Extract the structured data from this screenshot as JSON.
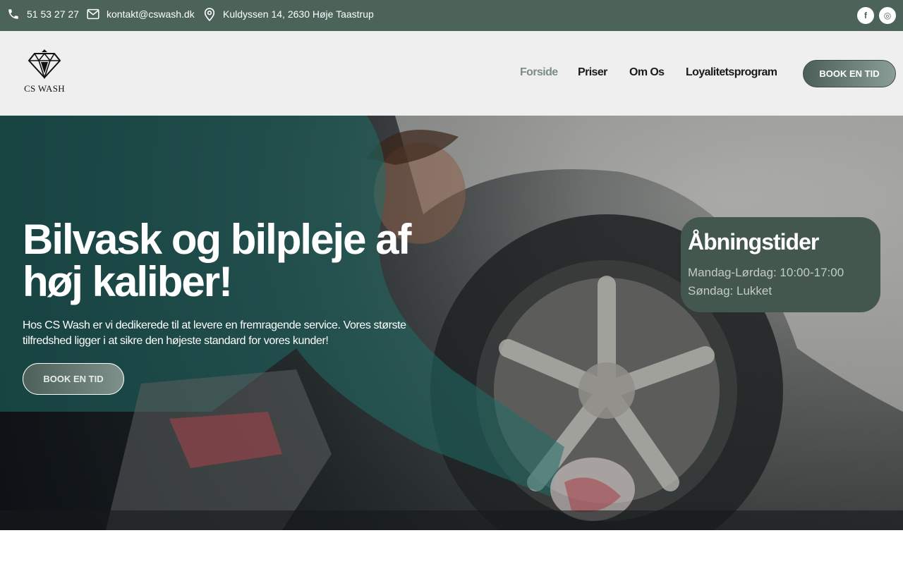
{
  "topbar": {
    "phone": "51 53 27 27",
    "email": "kontakt@cswash.dk",
    "address": "Kuldyssen 14, 2630 Høje Taastrup",
    "icons": [
      "phone-icon",
      "mail-icon",
      "location-pin-icon",
      "facebook-icon",
      "instagram-icon"
    ],
    "facebook_glyph": "f",
    "instagram_glyph": "◎"
  },
  "header": {
    "logo_text": "CS WASH",
    "nav": [
      {
        "label": "Forside",
        "active": true
      },
      {
        "label": "Priser",
        "active": false
      },
      {
        "label": "Om Os",
        "active": false
      },
      {
        "label": "Loyalitetsprogram",
        "active": false
      }
    ],
    "cta_label": "BOOK EN TID"
  },
  "hero": {
    "title_line1": "Bilvask og bilpleje af",
    "title_line2": "høj kaliber!",
    "subtitle": "Hos CS Wash er vi dedikerede til at levere en fremragende service. Vores største tilfredshed ligger i at sikre den højeste standard for vores kunder!",
    "cta_label": "BOOK EN TID"
  },
  "opening_hours": {
    "title": "Åbningstider",
    "lines": [
      "Mandag-Lørdag: 10:00-17:00",
      "Søndag: Lukket"
    ]
  },
  "colors": {
    "topbar_bg": "#4b6359",
    "header_bg": "#efefef",
    "nav_active": "#7d8d86",
    "hours_card_bg": "#44574f"
  }
}
